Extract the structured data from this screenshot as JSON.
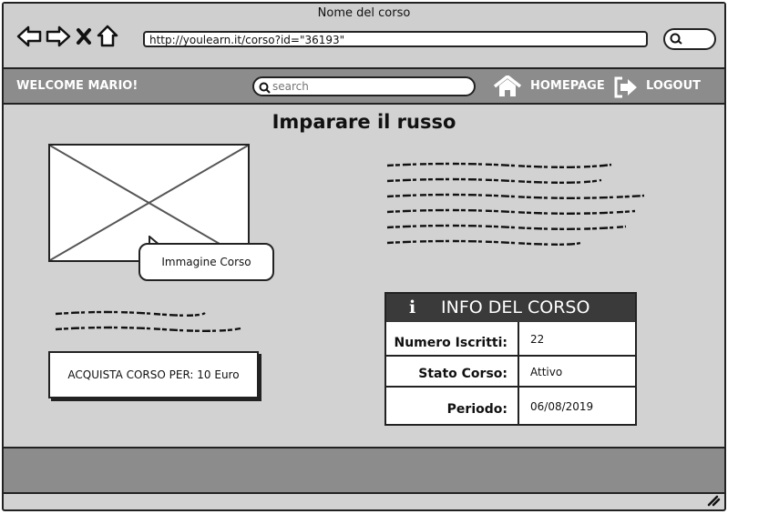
{
  "window": {
    "title": "Nome del corso",
    "url": "http://youlearn.it/corso?id=\"36193\""
  },
  "menubar": {
    "welcome": "WELCOME MARIO!",
    "search_placeholder": "search",
    "homepage": "HOMEPAGE",
    "logout": "LOGOUT"
  },
  "course": {
    "title": "Imparare il russo",
    "image_caption": "Immagine Corso",
    "buy_label": "ACQUISTA CORSO PER: 10 Euro"
  },
  "info": {
    "header_icon": "i",
    "header": "INFO DEL CORSO",
    "rows": [
      {
        "label": "Numero Iscritti:",
        "value": "22"
      },
      {
        "label": "Stato Corso:",
        "value": "Attivo"
      },
      {
        "label": "Periodo:",
        "value": "06/08/2019"
      }
    ]
  },
  "icons": [
    "back-arrow-icon",
    "forward-arrow-icon",
    "close-icon",
    "home-icon",
    "search-icon",
    "logout-icon",
    "info-icon",
    "resize-grip-icon"
  ]
}
